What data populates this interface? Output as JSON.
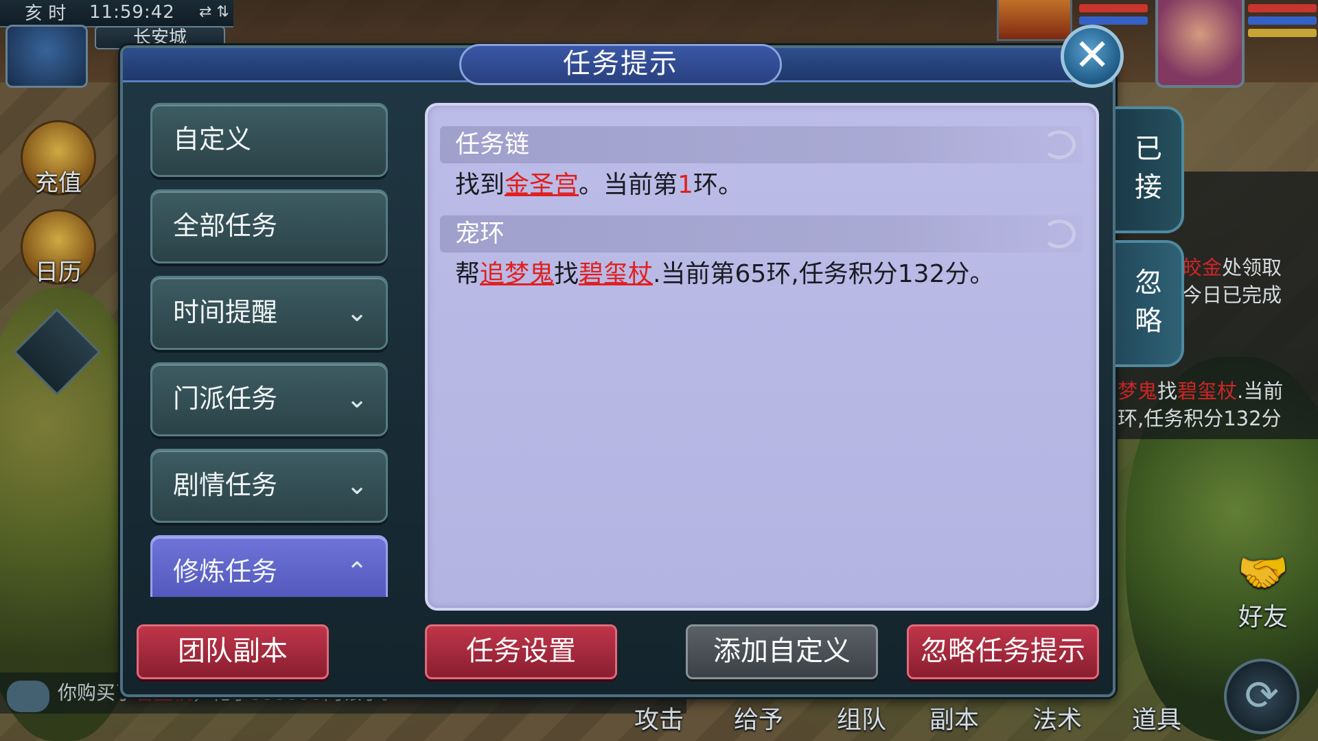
{
  "hud": {
    "shichen": "亥 时",
    "time": "11:59:42",
    "net_indicator": "⇄ ⇅",
    "map_name": "长安城",
    "side_buttons": [
      {
        "label": "充值",
        "icon": "recharge-icon"
      },
      {
        "label": "日历",
        "icon": "calendar-icon"
      }
    ]
  },
  "dialog": {
    "title": "任务提示",
    "close_icon": "close-icon",
    "tabs": [
      {
        "label": "自定义",
        "chevron": ""
      },
      {
        "label": "全部任务",
        "chevron": ""
      },
      {
        "label": "时间提醒",
        "chevron": "⌄"
      },
      {
        "label": "门派任务",
        "chevron": "⌄"
      },
      {
        "label": "剧情任务",
        "chevron": "⌄"
      },
      {
        "label": "修炼任务",
        "chevron": "⌃"
      }
    ],
    "active_tab_index": 5,
    "sections": [
      {
        "header": "任务链",
        "text_before": "找到",
        "link1": "金圣宫",
        "text_mid": "。当前第",
        "number": "1",
        "text_after": "环。"
      },
      {
        "header": "宠环",
        "text_before": "帮",
        "link1": "追梦鬼",
        "text_mid": "找",
        "link2": "碧玺杖",
        "text_after": ".当前第65环,任务积分132分。"
      }
    ],
    "side_tabs": {
      "accepted": "已\n接",
      "ignored": "忽\n略"
    },
    "buttons": {
      "team_dungeon": "团队副本",
      "task_settings": "任务设置",
      "add_custom": "添加自定义",
      "ignore_hint": "忽略任务提示"
    }
  },
  "tracker": {
    "line1_red": "皎金",
    "line1_rest": "处领取",
    "line2": "今日已完成",
    "line3_red1": "梦鬼",
    "line3_mid": "找",
    "line3_red2": "碧玺杖",
    "line3_rest": ".当前",
    "line4": "环,任务积分132分"
  },
  "chat": {
    "message_prefix": "你购买了",
    "message_item": "碧玺杖",
    "message_rest": "，花了333333两银子。"
  },
  "bottom_bar": {
    "buttons": [
      "攻击",
      "给予",
      "组队",
      "副本",
      "法术",
      "道具"
    ],
    "friend": "好友",
    "refresh_icon": "⟳"
  },
  "colors": {
    "link_red": "#e0201e",
    "panel_lavender": "#b8b8e4",
    "active_tab": "#5e64c8",
    "action_button": "#a82a3e"
  }
}
